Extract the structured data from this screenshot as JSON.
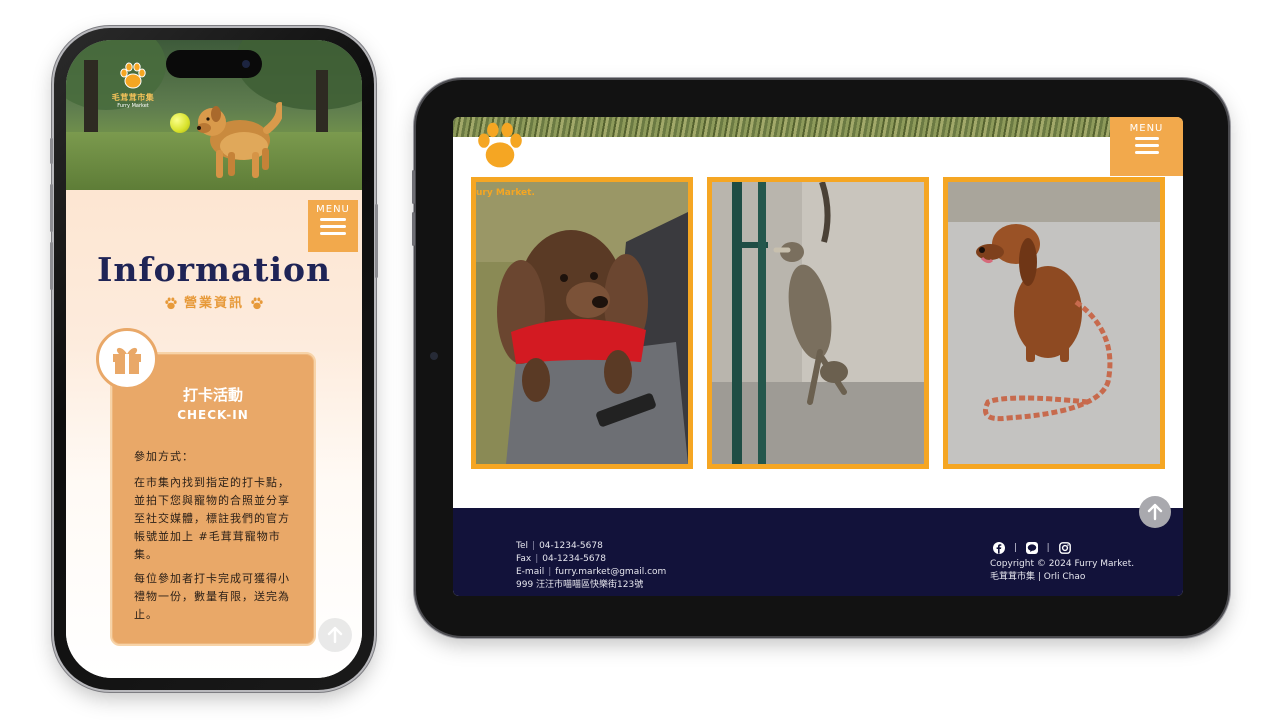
{
  "phone": {
    "brand": {
      "name": "毛茸茸市集",
      "sub": "Furry Market"
    },
    "menu_label": "MENU",
    "heading": "Information",
    "subheading": "營業資訊",
    "checkin": {
      "title": "打卡活動",
      "subtitle": "CHECK-IN",
      "method_label": "參加方式：",
      "p1": "在市集內找到指定的打卡點，並拍下您與寵物的合照並分享至社交媒體，標註我們的官方帳號並加上 #毛茸茸寵物市集。",
      "p2": "每位參加者打卡完成可獲得小禮物一份，數量有限，送完為止。"
    }
  },
  "tablet": {
    "menu_label": "MENU",
    "photo_caption": "ury Market.",
    "photos": [
      {
        "subject": "long-haired dachshund in red sweater in a stroller"
      },
      {
        "subject": "tabby cat climbing a green pole"
      },
      {
        "subject": "brown dachshund with braided leash"
      }
    ],
    "footer": {
      "tel_label": "Tel",
      "tel": "04-1234-5678",
      "fax_label": "Fax",
      "fax": "04-1234-5678",
      "email_label": "E-mail",
      "email": "furry.market@gmail.com",
      "address": "999 汪汪市喵喵區快樂街123號",
      "copyright": "Copyright © 2024 Furry Market.",
      "credit": "毛茸茸市集 | Orli Chao",
      "social_icons": [
        "facebook-icon",
        "line-icon",
        "instagram-icon"
      ]
    }
  },
  "colors": {
    "accent_orange": "#f5a623",
    "card_orange": "#e9a868",
    "navy": "#1f2456",
    "footer_navy": "#12123a"
  }
}
